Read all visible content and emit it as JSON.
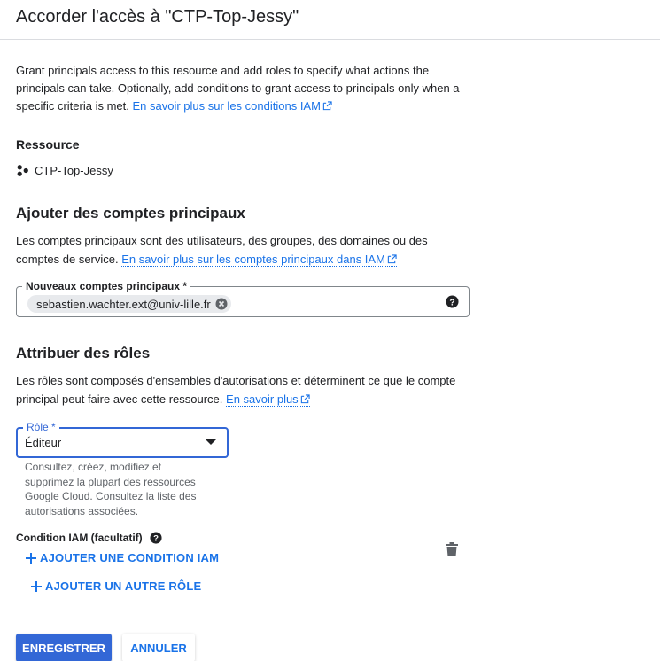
{
  "dialog": {
    "title": "Accorder l'accès à \"CTP-Top-Jessy\""
  },
  "intro": {
    "text": "Grant principals access to this resource and add roles to specify what actions the principals can take. Optionally, add conditions to grant access to principals only when a specific criteria is met.",
    "link": "En savoir plus sur les conditions IAM"
  },
  "resource": {
    "heading": "Ressource",
    "name": "CTP-Top-Jessy",
    "icon": "project-icon"
  },
  "principals": {
    "heading": "Ajouter des comptes principaux",
    "description": "Les comptes principaux sont des utilisateurs, des groupes, des domaines ou des comptes de service.",
    "link": "En savoir plus sur les comptes principaux dans IAM",
    "field_label": "Nouveaux comptes principaux *",
    "chip_value": "sebastien.wachter.ext@univ-lille.fr"
  },
  "roles": {
    "heading": "Attribuer des rôles",
    "description": "Les rôles sont composés d'ensembles d'autorisations et déterminent ce que le compte principal peut faire avec cette ressource.",
    "link": "En savoir plus",
    "role_label": "Rôle *",
    "role_value": "Éditeur",
    "role_hint": "Consultez, créez, modifiez et supprimez la plupart des ressources Google Cloud. Consultez la liste des autorisations associées.",
    "condition_label": "Condition IAM (facultatif)",
    "add_condition": "AJOUTER UNE CONDITION IAM",
    "add_role": "AJOUTER UN AUTRE RÔLE"
  },
  "actions": {
    "save": "ENREGISTRER",
    "cancel": "ANNULER"
  },
  "colors": {
    "accent": "#1a73e8",
    "primary_button": "#3367d6",
    "text": "#202124",
    "secondary_text": "#5f6368"
  }
}
